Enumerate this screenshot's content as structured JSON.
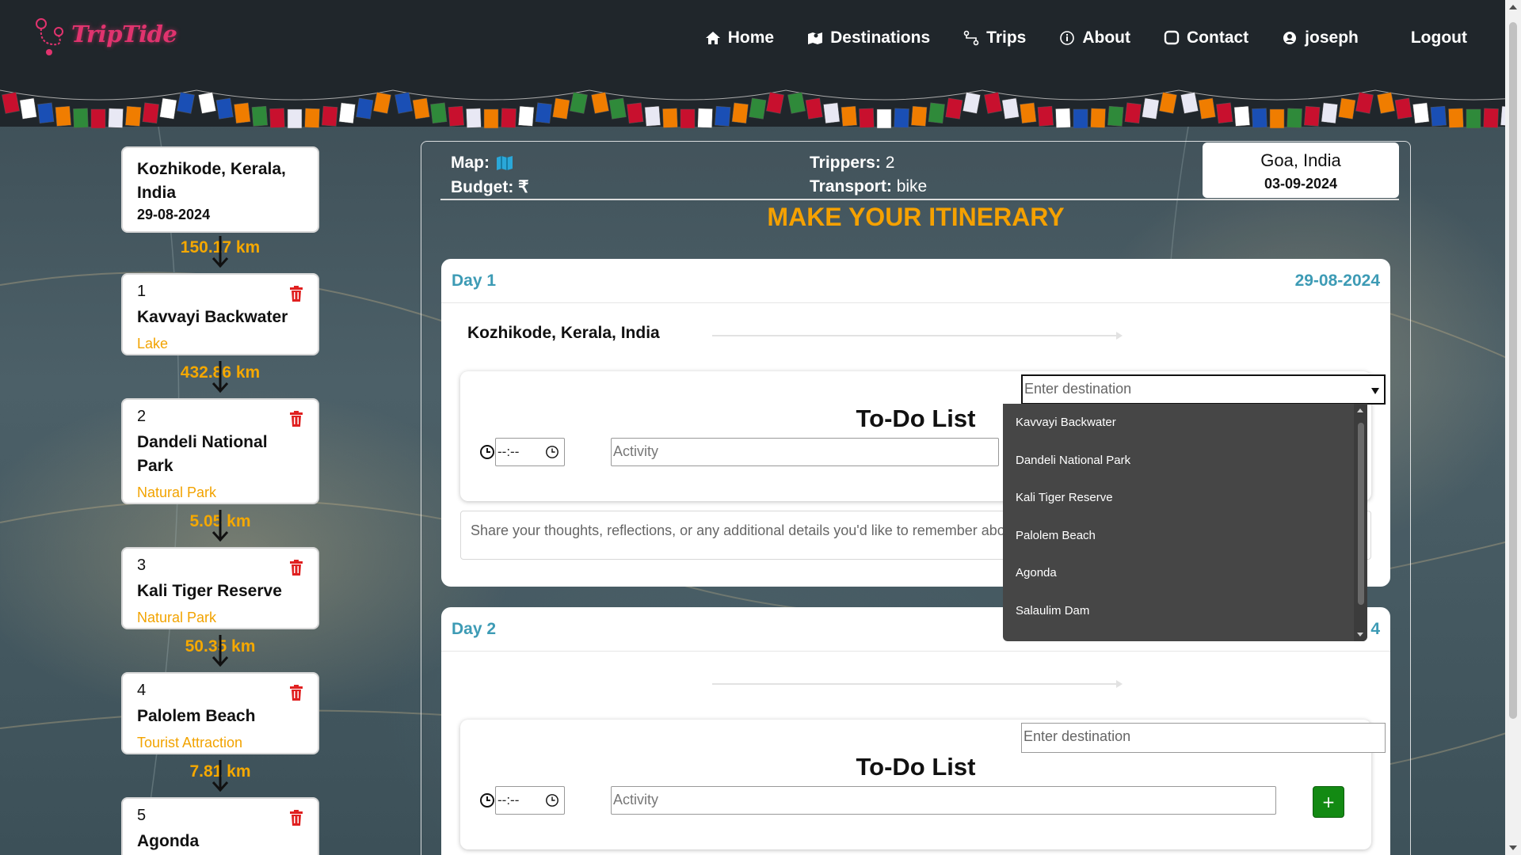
{
  "brand": {
    "logo_text": "TripTide"
  },
  "nav": {
    "items": [
      {
        "label": "Home",
        "icon": "home-icon"
      },
      {
        "label": "Destinations",
        "icon": "map-icon"
      },
      {
        "label": "Trips",
        "icon": "route-icon"
      },
      {
        "label": "About",
        "icon": "info-icon"
      },
      {
        "label": "Contact",
        "icon": "chat-icon"
      },
      {
        "label": "joseph",
        "icon": "user-icon"
      },
      {
        "label": "Logout",
        "icon": ""
      }
    ]
  },
  "sidebar": {
    "start": {
      "name": "Kozhikode, Kerala, India",
      "date": "29-08-2024"
    },
    "distances": [
      "150.17 km",
      "432.86 km",
      "5.05 km",
      "50.35 km",
      "7.81 km"
    ],
    "stops": [
      {
        "num": "1",
        "name": "Kavvayi Backwater",
        "type": "Lake"
      },
      {
        "num": "2",
        "name": "Dandeli National Park",
        "type": "Natural Park"
      },
      {
        "num": "3",
        "name": "Kali Tiger Reserve",
        "type": "Natural Park"
      },
      {
        "num": "4",
        "name": "Palolem Beach",
        "type": "Tourist Attraction"
      },
      {
        "num": "5",
        "name": "Agonda",
        "type": ""
      }
    ]
  },
  "trip_info": {
    "map_label": "Map:",
    "budget_label": "Budget:",
    "budget_value": "₹",
    "trippers_label": "Trippers:",
    "trippers_value": "2",
    "transport_label": "Transport:",
    "transport_value": "bike",
    "destination": "Goa, India",
    "end_date": "03-09-2024"
  },
  "itinerary": {
    "heading": "MAKE YOUR ITINERARY",
    "days": [
      {
        "label": "Day 1",
        "date": "29-08-2024",
        "from": "Kozhikode, Kerala, India",
        "todo_title": "To-Do List",
        "destination_placeholder": "Enter destination",
        "time_placeholder": "--:--",
        "activity_placeholder": "Activity",
        "notes_placeholder": "Share your thoughts, reflections, or any additional details you'd like to remember about"
      },
      {
        "label": "Day 2",
        "date": "4",
        "from": "",
        "todo_title": "To-Do List",
        "destination_placeholder": "Enter destination",
        "time_placeholder": "--:--",
        "activity_placeholder": "Activity",
        "add_label": "+"
      }
    ]
  },
  "dropdown": {
    "options": [
      "Kavvayi Backwater",
      "Dandeli National Park",
      "Kali Tiger Reserve",
      "Palolem Beach",
      "Agonda",
      "Salaulim Dam"
    ]
  },
  "colors": {
    "accent": "#f5a800",
    "day_label": "#3d9bb5",
    "trash": "#e02020",
    "add_button": "#138a13"
  }
}
